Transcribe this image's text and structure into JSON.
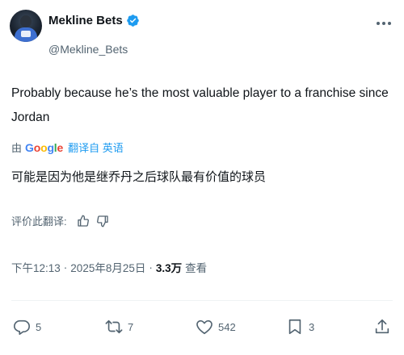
{
  "author": {
    "display_name": "Mekline Bets",
    "handle": "@Mekline_Bets"
  },
  "tweet": {
    "text": "Probably because he’s the most valuable player to a franchise since Jordan",
    "translation_prefix": "由",
    "translation_provider": "Google",
    "translation_link": "翻译自 英语",
    "translated_text": "可能是因为他是继乔丹之后球队最有价值的球员",
    "rate_label": "评价此翻译:"
  },
  "meta": {
    "time": "下午12:13",
    "date": "2025年8月25日",
    "separator": "·",
    "views_count": "3.3万",
    "views_label": "查看"
  },
  "actions": {
    "replies": "5",
    "reposts": "7",
    "likes": "542",
    "bookmarks": "3"
  },
  "colors": {
    "accent": "#1d9bf0",
    "secondary_text": "#536471",
    "primary_text": "#0f1419"
  },
  "icons": [
    "verified-badge-icon",
    "more-icon",
    "thumbs-up-icon",
    "thumbs-down-icon",
    "reply-icon",
    "repost-icon",
    "like-icon",
    "bookmark-icon",
    "share-icon"
  ]
}
